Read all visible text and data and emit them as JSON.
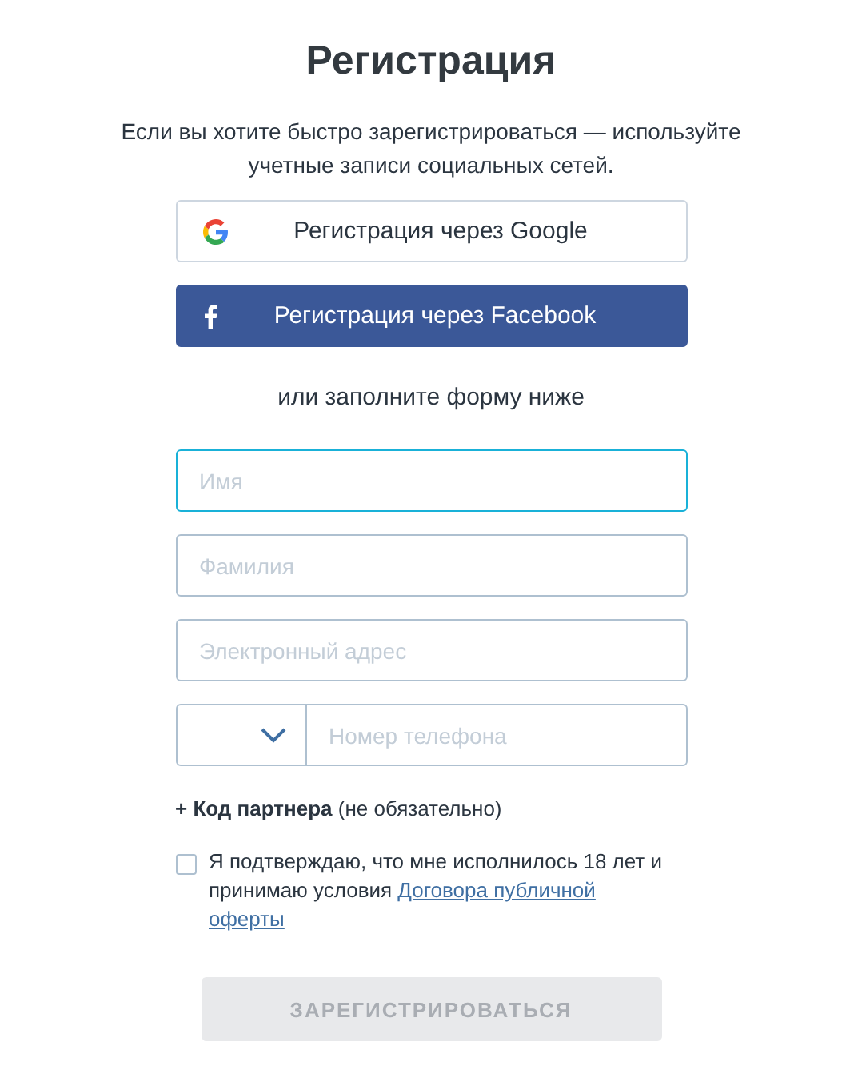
{
  "title": "Регистрация",
  "subtitle": "Если вы хотите быстро зарегистрироваться — используйте учетные записи социальных сетей.",
  "social_buttons": [
    {
      "kind": "google",
      "label": "Регистрация через Google"
    },
    {
      "kind": "facebook",
      "label": "Регистрация через Facebook"
    }
  ],
  "divider_text": "или заполните форму ниже",
  "fields": [
    {
      "kind": "text",
      "placeholder": "Имя",
      "focused": true
    },
    {
      "kind": "text",
      "placeholder": "Фамилия",
      "focused": false
    },
    {
      "kind": "text",
      "placeholder": "Электронный адрес",
      "focused": false
    },
    {
      "kind": "phone",
      "placeholder": "Номер телефона",
      "focused": false
    }
  ],
  "partner_code": {
    "label": "+ Код партнера",
    "note": "(не обязательно)"
  },
  "consent": {
    "checked": false,
    "text": "Я подтверждаю, что мне исполнилось 18 лет и принимаю условия",
    "link_lines": [
      "Договора публичной",
      "оферты"
    ]
  },
  "submit": {
    "label": "ЗАРЕГИСТРИРОВАТЬСЯ",
    "disabled": true
  }
}
